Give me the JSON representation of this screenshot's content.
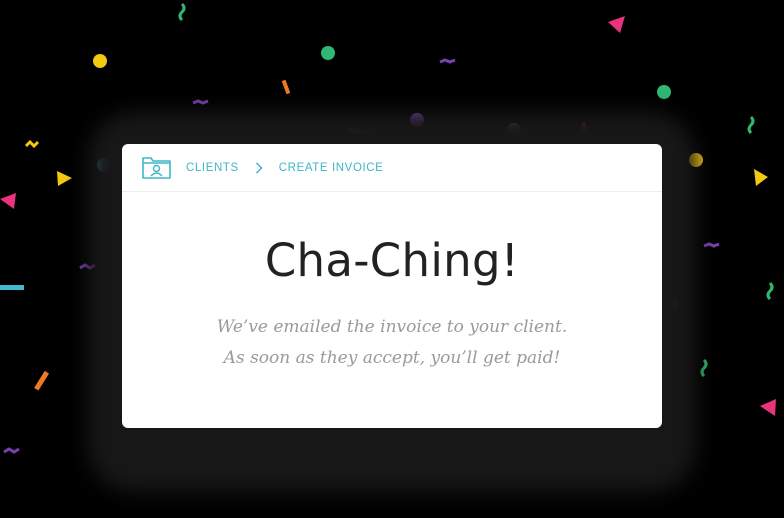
{
  "breadcrumb": {
    "icon": "clients-folder-icon",
    "items": [
      {
        "label": "CLIENTS"
      },
      {
        "label": "CREATE INVOICE"
      }
    ],
    "separator_icon": "chevron-right-icon"
  },
  "main": {
    "title": "Cha-Ching!",
    "message_lines": [
      "We’ve emailed the invoice to your client.",
      "As soon as they accept, you’ll get paid!"
    ]
  },
  "colors": {
    "accent": "#3fb6c8",
    "title": "#222222",
    "message": "#9a9a9a",
    "confetti": [
      "#f2c811",
      "#41b9d1",
      "#2fb872",
      "#8a49b7",
      "#e9337c",
      "#f07a21",
      "#7b3fb2"
    ]
  }
}
